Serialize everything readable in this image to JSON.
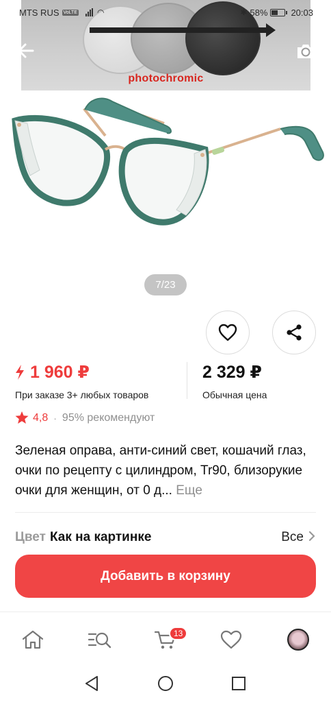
{
  "status_bar": {
    "carrier": "MTS RUS",
    "volte": "VoLTE",
    "battery": "58%",
    "time": "20:03"
  },
  "gallery": {
    "banner_text": "photochromic",
    "counter": "7/23"
  },
  "price": {
    "sale": "1 960 ₽",
    "sale_note": "При заказе 3+ любых товаров",
    "regular": "2 329 ₽",
    "regular_note": "Обычная цена"
  },
  "rating": {
    "score": "4,8",
    "separator": "·",
    "recommend": "95% рекомендуют"
  },
  "product": {
    "title": "Зеленая оправа, анти-синий свет, кошачий глаз, очки по рецепту с цилиндром, Tr90, близорукие очки для женщин, от 0 д...",
    "more": "Еще"
  },
  "color_option": {
    "label": "Цвет",
    "value": "Как на картинке",
    "all": "Все"
  },
  "cta": {
    "add_to_cart": "Добавить в корзину"
  },
  "tabbar": {
    "cart_badge": "13"
  },
  "colors": {
    "accent": "#ee3c3c",
    "button": "#f04545",
    "frame_green": "#3f7a6c",
    "temple_gold": "#d9b28f"
  },
  "icons": [
    "back-arrow-icon",
    "camera-icon",
    "heart-icon",
    "share-icon",
    "lightning-icon",
    "star-icon",
    "chevron-right-icon",
    "home-icon",
    "catalog-search-icon",
    "cart-icon",
    "heart-outline-icon",
    "avatar",
    "nav-back-icon",
    "nav-home-icon",
    "nav-recents-icon"
  ]
}
